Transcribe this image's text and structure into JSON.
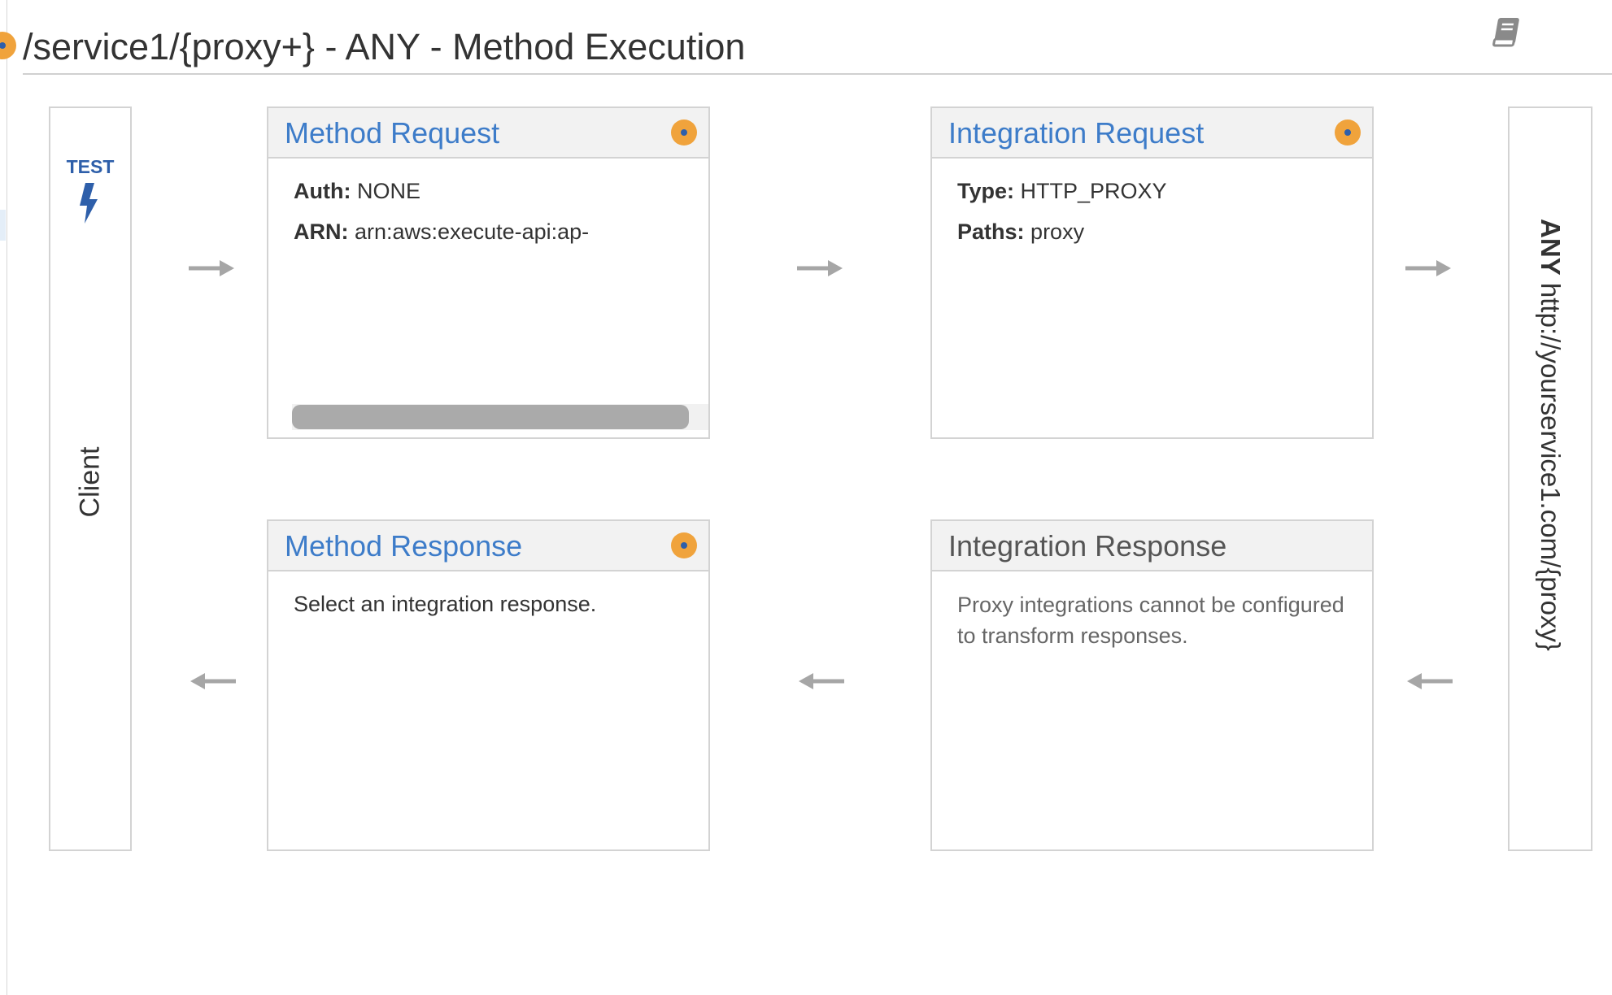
{
  "header": {
    "title": "/service1/{proxy+} - ANY - Method Execution",
    "status_icon": "orange-dot-icon",
    "docs_icon": "book-icon"
  },
  "client": {
    "test_label": "TEST",
    "test_icon": "lightning-bolt-icon",
    "label": "Client"
  },
  "method_request": {
    "title": "Method Request",
    "auth_label": "Auth:",
    "auth_value": "NONE",
    "arn_label": "ARN:",
    "arn_value": "arn:aws:execute-api:ap-"
  },
  "integration_request": {
    "title": "Integration Request",
    "type_label": "Type:",
    "type_value": "HTTP_PROXY",
    "paths_label": "Paths:",
    "paths_value": "proxy"
  },
  "method_response": {
    "title": "Method Response",
    "body": "Select an integration response."
  },
  "integration_response": {
    "title": "Integration Response",
    "body": "Proxy integrations cannot be configured to transform responses."
  },
  "endpoint": {
    "method": "ANY",
    "url": "http://yourservice1.com/{proxy}"
  },
  "colors": {
    "link": "#3d7cc9",
    "accent_orange": "#f0a33c",
    "accent_blue": "#2e5faa",
    "arrow": "#a6a6a6",
    "border": "#d3d3d3"
  }
}
